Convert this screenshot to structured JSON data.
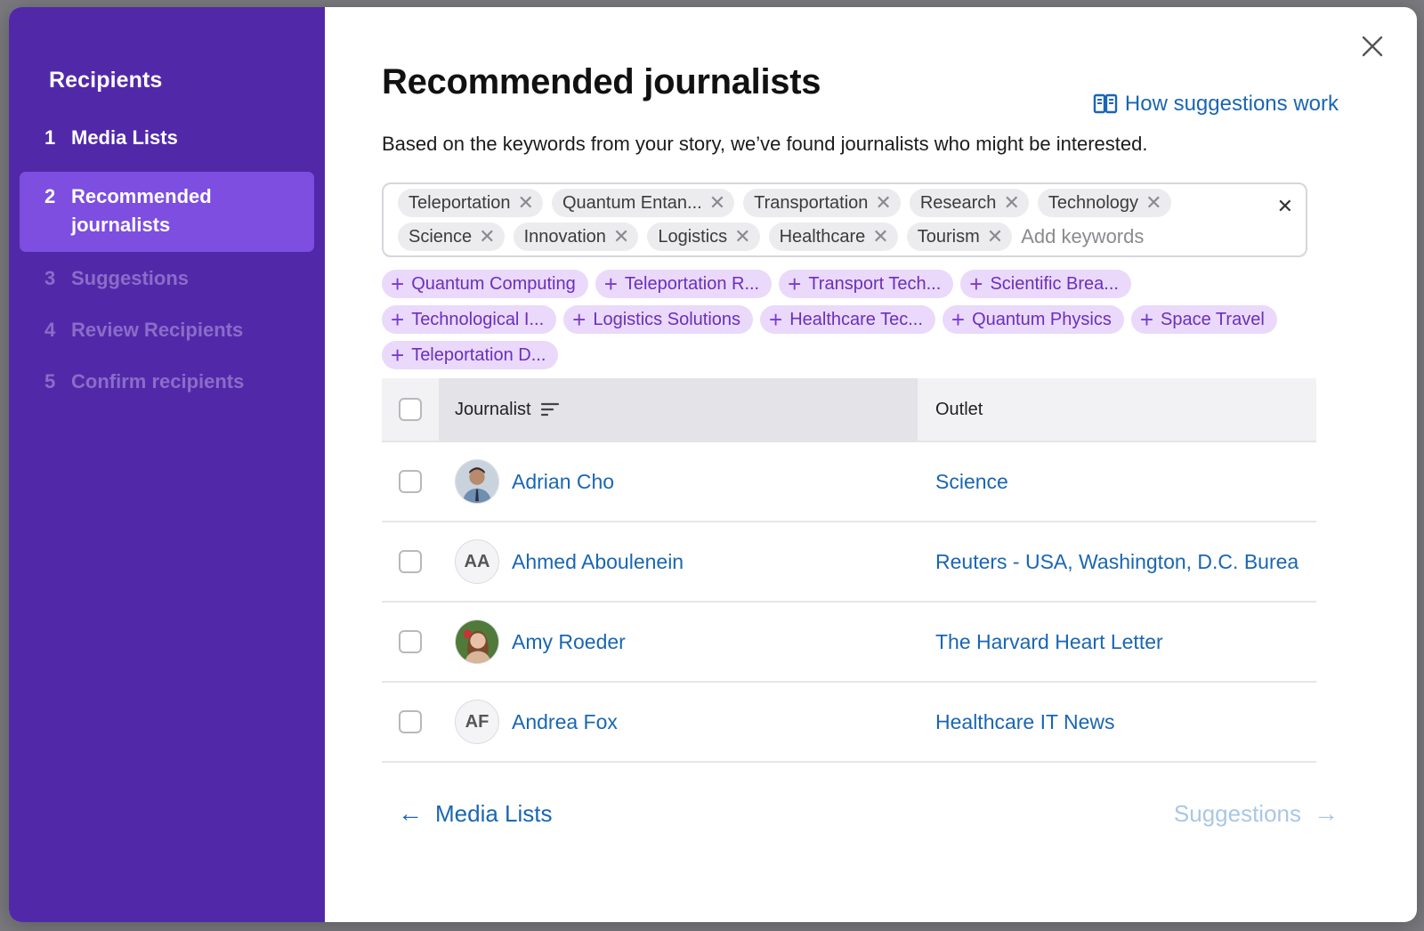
{
  "sidebar": {
    "title": "Recipients",
    "steps": [
      {
        "num": "1",
        "label": "Media Lists",
        "state": "done"
      },
      {
        "num": "2",
        "label": "Recommended journalists",
        "state": "active"
      },
      {
        "num": "3",
        "label": "Suggestions",
        "state": "pending"
      },
      {
        "num": "4",
        "label": "Review Recipients",
        "state": "pending"
      },
      {
        "num": "5",
        "label": "Confirm recipients",
        "state": "pending"
      }
    ]
  },
  "header": {
    "title": "Recommended journalists",
    "how_link": "How suggestions work",
    "subtitle": "Based on the keywords from your story, we’ve found journalists who might be interested."
  },
  "keywords": {
    "chips": [
      "Teleportation",
      "Quantum Entan...",
      "Transportation",
      "Research",
      "Technology",
      "Science",
      "Innovation",
      "Logistics",
      "Healthcare",
      "Tourism"
    ],
    "placeholder": "Add keywords"
  },
  "suggested_keywords": [
    "Quantum Computing",
    "Teleportation R...",
    "Transport Tech...",
    "Scientific Brea...",
    "Technological I...",
    "Logistics Solutions",
    "Healthcare Tec...",
    "Quantum Physics",
    "Space Travel",
    "Teleportation D..."
  ],
  "table": {
    "columns": {
      "journalist": "Journalist",
      "outlet": "Outlet"
    },
    "rows": [
      {
        "name": "Adrian Cho",
        "initials": "",
        "photo": "photo-male",
        "outlet": "Science"
      },
      {
        "name": "Ahmed Aboulenein",
        "initials": "AA",
        "photo": "",
        "outlet": "Reuters - USA, Washington, D.C. Burea"
      },
      {
        "name": "Amy Roeder",
        "initials": "",
        "photo": "photo-female",
        "outlet": "The Harvard Heart Letter"
      },
      {
        "name": "Andrea Fox",
        "initials": "AF",
        "photo": "",
        "outlet": "Healthcare IT News"
      }
    ]
  },
  "footer": {
    "back_label": "Media Lists",
    "next_label": "Suggestions"
  },
  "colors": {
    "sidebar_bg": "#5129a8",
    "sidebar_active": "#7d4ee0",
    "link": "#1a66b2",
    "suggestion_chip": "#ead9fa"
  }
}
